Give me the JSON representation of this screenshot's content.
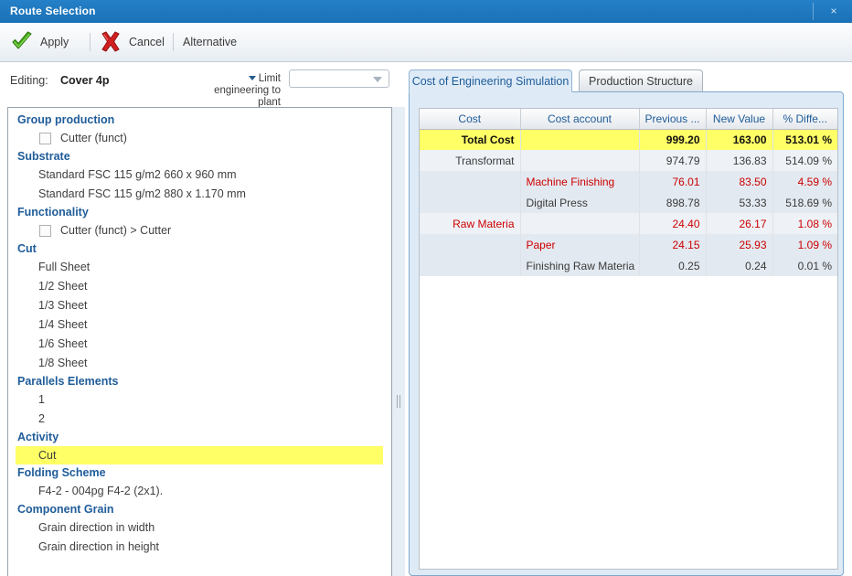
{
  "window": {
    "title": "Route Selection",
    "close_label": "×"
  },
  "toolbar": {
    "apply_label": "Apply",
    "cancel_label": "Cancel",
    "alternative_label": "Alternative"
  },
  "editing": {
    "label": "Editing:",
    "value": "Cover  4p",
    "limit_label": "Limit engineering to plant",
    "limit_value": "",
    "limit_placeholder": ""
  },
  "tree": {
    "groups": [
      {
        "label": "Group production",
        "items": [
          {
            "label": "Cutter (funct)",
            "checkbox": true,
            "selected": false
          }
        ]
      },
      {
        "label": "Substrate",
        "items": [
          {
            "label": "Standard FSC 115 g/m2 660 x 960 mm",
            "checkbox": false,
            "selected": false
          },
          {
            "label": "Standard FSC 115 g/m2 880 x 1.170 mm",
            "checkbox": false,
            "selected": false
          }
        ]
      },
      {
        "label": "Functionality",
        "items": [
          {
            "label": "Cutter (funct)  >  Cutter",
            "checkbox": true,
            "selected": false
          }
        ]
      },
      {
        "label": "Cut",
        "items": [
          {
            "label": "Full Sheet",
            "checkbox": false,
            "selected": false
          },
          {
            "label": "1/2 Sheet",
            "checkbox": false,
            "selected": false
          },
          {
            "label": "1/3 Sheet",
            "checkbox": false,
            "selected": false
          },
          {
            "label": "1/4 Sheet",
            "checkbox": false,
            "selected": false
          },
          {
            "label": "1/6 Sheet",
            "checkbox": false,
            "selected": false
          },
          {
            "label": "1/8 Sheet",
            "checkbox": false,
            "selected": false
          }
        ]
      },
      {
        "label": "Parallels Elements",
        "items": [
          {
            "label": "1",
            "checkbox": false,
            "selected": false
          },
          {
            "label": "2",
            "checkbox": false,
            "selected": false
          }
        ]
      },
      {
        "label": "Activity",
        "items": [
          {
            "label": "Cut",
            "checkbox": false,
            "selected": true
          }
        ]
      },
      {
        "label": "Folding Scheme",
        "items": [
          {
            "label": "F4-2 - 004pg F4-2 (2x1).",
            "checkbox": false,
            "selected": false
          }
        ]
      },
      {
        "label": "Component Grain",
        "items": [
          {
            "label": "Grain direction in width",
            "checkbox": false,
            "selected": false
          },
          {
            "label": "Grain direction in height",
            "checkbox": false,
            "selected": false
          }
        ]
      }
    ]
  },
  "tabs": [
    {
      "label": "Cost of Engineering Simulation",
      "active": true
    },
    {
      "label": "Production Structure",
      "active": false
    }
  ],
  "grid": {
    "columns": [
      "Cost",
      "Cost account",
      "Previous ...",
      "New Value",
      "% Diffe..."
    ],
    "rows": [
      {
        "style": "total",
        "cost": "Total Cost",
        "account": "",
        "previous": "999.20",
        "new_value": "163.00",
        "pct_diff": "513.01 %",
        "color": "dark"
      },
      {
        "style": "odd",
        "cost": "Transformat",
        "account": "",
        "previous": "974.79",
        "new_value": "136.83",
        "pct_diff": "514.09 %",
        "color": "dark"
      },
      {
        "style": "even",
        "cost": "",
        "account": "Machine Finishing",
        "previous": "76.01",
        "new_value": "83.50",
        "pct_diff": "4.59 %",
        "color": "red"
      },
      {
        "style": "even",
        "cost": "",
        "account": "Digital Press",
        "previous": "898.78",
        "new_value": "53.33",
        "pct_diff": "518.69 %",
        "color": "dark"
      },
      {
        "style": "odd",
        "cost": "Raw Materia",
        "account": "",
        "previous": "24.40",
        "new_value": "26.17",
        "pct_diff": "1.08 %",
        "color": "red"
      },
      {
        "style": "even",
        "cost": "",
        "account": "Paper",
        "previous": "24.15",
        "new_value": "25.93",
        "pct_diff": "1.09 %",
        "color": "red"
      },
      {
        "style": "even",
        "cost": "",
        "account": "Finishing Raw Materia",
        "previous": "0.25",
        "new_value": "0.24",
        "pct_diff": "0.01 %",
        "color": "dark"
      }
    ]
  },
  "colors": {
    "titlebar": "#1e76bd",
    "accent": "#1f5c99",
    "highlight": "#ffff66",
    "negative": "#cc0000",
    "tab_active": "#deebf7"
  }
}
